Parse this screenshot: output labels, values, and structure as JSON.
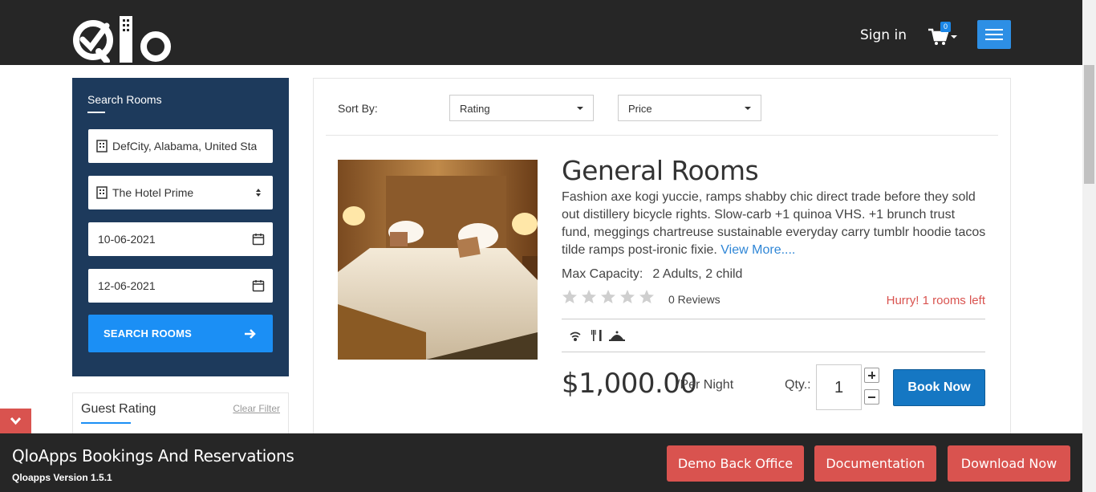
{
  "header": {
    "logo_text": "Qlo",
    "sign_in_label": "Sign in",
    "cart_count": "0",
    "cart_icon": "cart-icon",
    "menu_icon": "hamburger-icon"
  },
  "search": {
    "title": "Search Rooms",
    "location_value": "DefCity, Alabama, United States",
    "hotel_value": "The Hotel Prime",
    "checkin_value": "10-06-2021",
    "checkout_value": "12-06-2021",
    "button_label": "SEARCH ROOMS"
  },
  "filters": {
    "guest_rating_title": "Guest Rating",
    "clear_filter_label": "Clear Filter"
  },
  "sort": {
    "label": "Sort By:",
    "rating_selected": "Rating",
    "price_selected": "Price"
  },
  "room": {
    "title": "General Rooms",
    "description": "Fashion axe kogi yuccie, ramps shabby chic direct trade before they sold out distillery bicycle rights. Slow-carb +1 quinoa VHS. +1 brunch trust fund, meggings chartreuse sustainable everyday carry tumblr hoodie tacos tilde ramps post-ironic fixie.",
    "view_more": "View More....",
    "capacity_label": "Max Capacity:",
    "capacity_value": "2 Adults, 2 child",
    "rating_stars": 0,
    "reviews": "0 Reviews",
    "availability": "Hurry! 1 rooms left",
    "price": "$1,000.00",
    "per_night": "/Per Night",
    "qty_label": "Qty.:",
    "qty_value": "1",
    "book_label": "Book Now"
  },
  "footer": {
    "title": "QloApps Bookings And Reservations",
    "version": "Qloapps Version 1.5.1",
    "demo_label": "Demo Back Office",
    "docs_label": "Documentation",
    "download_label": "Download Now"
  },
  "colors": {
    "header_bg": "#262626",
    "search_panel": "#1d3a5c",
    "primary_blue": "#1b8ff5",
    "accent_red": "#d9534f"
  }
}
